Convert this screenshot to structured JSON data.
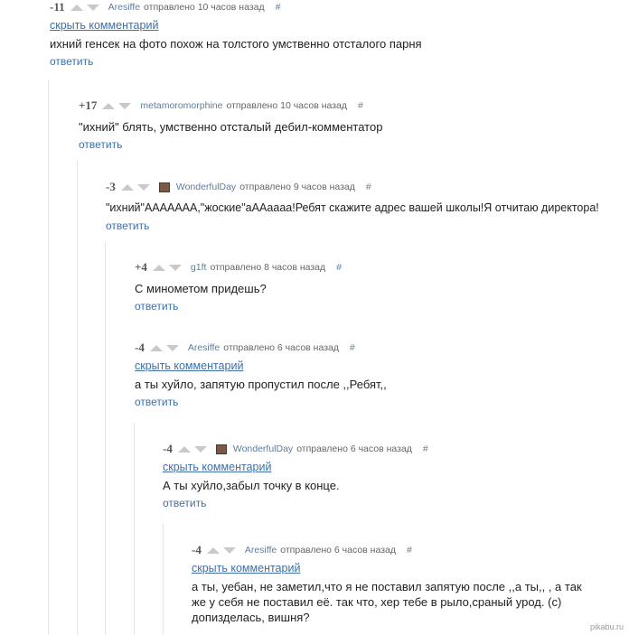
{
  "comments": [
    {
      "score": "-11",
      "user": "Aresiffe",
      "meta": "отправлено 10 часов назад",
      "hash": "#",
      "hide": "скрыть комментарий",
      "text": "ихний генсек на фото похож на толстого умственно отсталого парня",
      "reply": "ответить"
    },
    {
      "score": "+17",
      "user": "metamoromorphine",
      "meta": "отправлено 10 часов назад",
      "hash": "#",
      "text": "\"ихний\" блять, умственно отсталый дебил-комментатор",
      "reply": "ответить"
    },
    {
      "score": "-3",
      "user": "WonderfulDay",
      "meta": "отправлено 9 часов назад",
      "hash": "#",
      "text": "\"ихний\"ААААААА,\"жоские\"аААаааа!Ребят скажите адрес вашей школы!Я отчитаю директора!",
      "reply": "ответить"
    },
    {
      "score": "+4",
      "user": "g1ft",
      "meta": "отправлено 8 часов назад",
      "hash": "#",
      "text": "С минометом придешь?",
      "reply": "ответить"
    },
    {
      "score": "-4",
      "user": "Aresiffe",
      "meta": "отправлено 6 часов назад",
      "hash": "#",
      "hide": "скрыть комментарий",
      "text": "а ты хуйло, запятую пропустил после ,,Ребят,,",
      "reply": "ответить"
    },
    {
      "score": "-4",
      "user": "WonderfulDay",
      "meta": "отправлено 6 часов назад",
      "hash": "#",
      "hide": "скрыть комментарий",
      "text": "А ты хуйло,забыл точку в конце.",
      "reply": "ответить"
    },
    {
      "score": "-4",
      "user": "Aresiffe",
      "meta": "отправлено 6 часов назад",
      "hash": "#",
      "hide": "скрыть комментарий",
      "text": "а ты, уебан, не заметил,что я не поставил запятую после ,,а ты,, , а так же у себя не поставил её. так что, хер тебе в рыло,сраный урод. (с) допизделась, вишня?"
    }
  ],
  "watermark": "pikabu.ru"
}
